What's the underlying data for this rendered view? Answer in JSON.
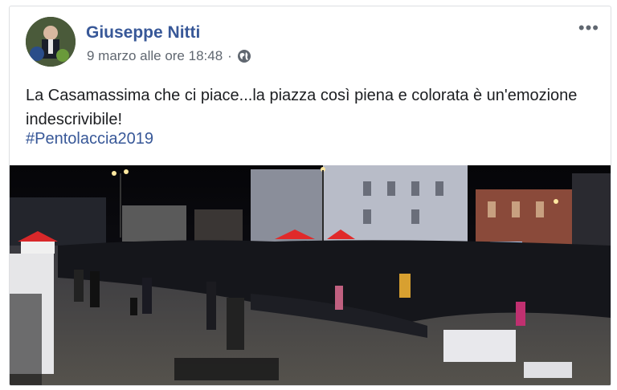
{
  "post": {
    "author": "Giuseppe Nitti",
    "timestamp": "9 marzo alle ore 18:48",
    "separator": "·",
    "audience_icon": "globe-icon",
    "options_icon": "more-options-icon",
    "text": "La Casamassima che ci piace...la piazza così piena e colorata è un'emozione indescrivibile!",
    "hashtag": "#Pentolaccia2019"
  },
  "colors": {
    "author": "#385898",
    "meta": "#606770",
    "text": "#1c1e21",
    "hashtag": "#385898"
  }
}
